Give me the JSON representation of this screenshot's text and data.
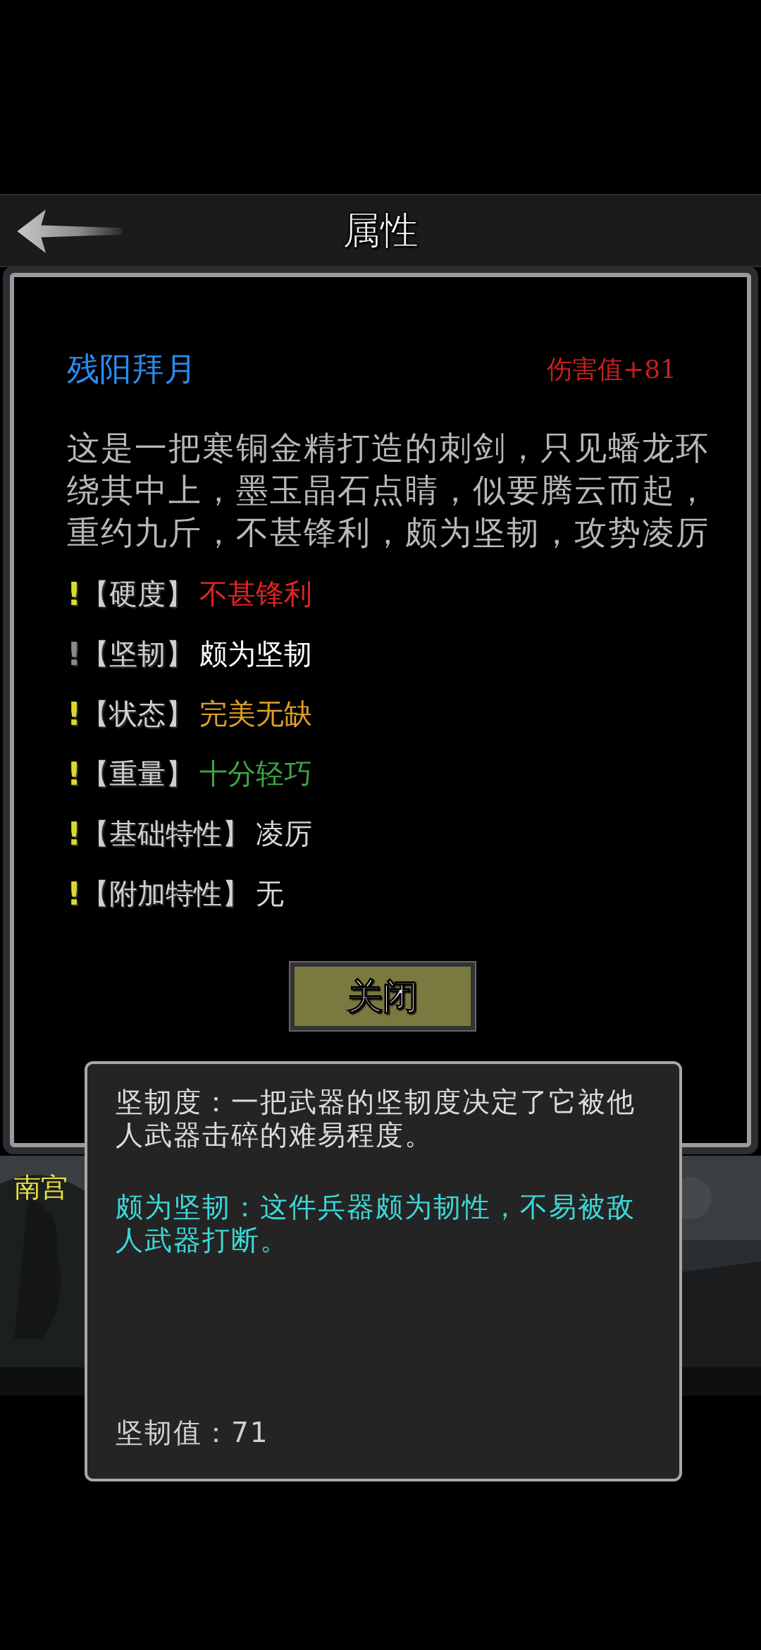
{
  "header": {
    "title": "属性"
  },
  "item": {
    "name": "残阳拜月",
    "damage": "伤害值+81",
    "description": "这是一把寒铜金精打造的刺剑，只见蟠龙环绕其中上，墨玉晶石点睛，似要腾云而起，重约九斤，不甚锋利，颇为坚韧，攻势凌厉"
  },
  "attributes": [
    {
      "mark": "!",
      "highlighted": true,
      "label": "【硬度】",
      "value": "不甚锋利",
      "color": "#e02424"
    },
    {
      "mark": "!",
      "highlighted": false,
      "label": "【坚韧】",
      "value": "颇为坚韧",
      "color": "#ffffff"
    },
    {
      "mark": "!",
      "highlighted": true,
      "label": "【状态】",
      "value": "完美无缺",
      "color": "#e0a126"
    },
    {
      "mark": "!",
      "highlighted": true,
      "label": "【重量】",
      "value": "十分轻巧",
      "color": "#3ea844"
    },
    {
      "mark": "!",
      "highlighted": true,
      "label": "【基础特性】",
      "value": "凌厉",
      "color": "#d8d8d8"
    },
    {
      "mark": "!",
      "highlighted": true,
      "label": "【附加特性】",
      "value": "无",
      "color": "#d8d8d8"
    }
  ],
  "close_button": "关闭",
  "background": {
    "location": "南宫"
  },
  "tooltip": {
    "definition": "坚韧度：一把武器的坚韧度决定了它被他人武器击碎的难易程度。",
    "detail": "颇为坚韧：这件兵器颇为韧性，不易被敌人武器打断。",
    "reading": "坚韧值：71"
  }
}
